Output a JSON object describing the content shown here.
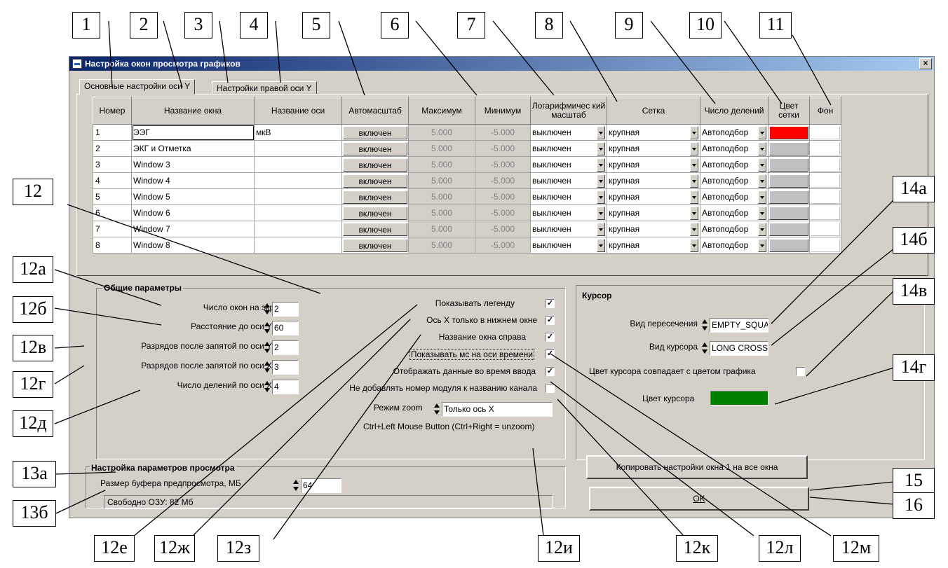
{
  "window": {
    "title": "Настройка окон просмотра графиков",
    "close_label": "×"
  },
  "tabs": [
    {
      "label": "Основные настройки оси Y"
    },
    {
      "label": "Настройки правой оси Y"
    }
  ],
  "table": {
    "headers": [
      "Номер",
      "Название окна",
      "Название оси",
      "Автомасштаб",
      "Максимум",
      "Минимум",
      "Логарифмичес кий масштаб",
      "Сетка",
      "Число делений",
      "Цвет сетки",
      "Фон"
    ],
    "rows": [
      {
        "num": "1",
        "name": "ЭЭГ",
        "axis": "мкВ",
        "auto": "включен",
        "max": "5.000",
        "min": "-5.000",
        "log": "выключен",
        "grid": "крупная",
        "div": "Автоподбор",
        "grid_color": "#ff0000"
      },
      {
        "num": "2",
        "name": "ЭКГ и Отметка",
        "axis": "",
        "auto": "включен",
        "max": "5.000",
        "min": "-5.000",
        "log": "выключен",
        "grid": "крупная",
        "div": "Автоподбор",
        "grid_color": "#c0c0c0"
      },
      {
        "num": "3",
        "name": "Window 3",
        "axis": "",
        "auto": "включен",
        "max": "5.000",
        "min": "-5.000",
        "log": "выключен",
        "grid": "крупная",
        "div": "Автоподбор",
        "grid_color": "#c0c0c0"
      },
      {
        "num": "4",
        "name": "Window 4",
        "axis": "",
        "auto": "включен",
        "max": "5.000",
        "min": "-5.000",
        "log": "выключен",
        "grid": "крупная",
        "div": "Автоподбор",
        "grid_color": "#c0c0c0"
      },
      {
        "num": "5",
        "name": "Window 5",
        "axis": "",
        "auto": "включен",
        "max": "5.000",
        "min": "-5.000",
        "log": "выключен",
        "grid": "крупная",
        "div": "Автоподбор",
        "grid_color": "#c0c0c0"
      },
      {
        "num": "6",
        "name": "Window 6",
        "axis": "",
        "auto": "включен",
        "max": "5.000",
        "min": "-5.000",
        "log": "выключен",
        "grid": "крупная",
        "div": "Автоподбор",
        "grid_color": "#c0c0c0"
      },
      {
        "num": "7",
        "name": "Window 7",
        "axis": "",
        "auto": "включен",
        "max": "5.000",
        "min": "-5.000",
        "log": "выключен",
        "grid": "крупная",
        "div": "Автоподбор",
        "grid_color": "#c0c0c0"
      },
      {
        "num": "8",
        "name": "Window 8",
        "axis": "",
        "auto": "включен",
        "max": "5.000",
        "min": "-5.000",
        "log": "выключен",
        "grid": "крупная",
        "div": "Автоподбор",
        "grid_color": "#c0c0c0"
      }
    ]
  },
  "general": {
    "title": "Общие параметры",
    "windows_on_screen_label": "Число окон на экране",
    "windows_on_screen": "2",
    "distance_label": "Расстояние до оси Y",
    "distance": "60",
    "digits_y_label": "Разрядов после запятой по оси Y",
    "digits_y": "2",
    "digits_x_label": "Разрядов после запятой по оси X",
    "digits_x": "3",
    "divisions_x_label": "Число делений по оси X",
    "divisions_x": "4",
    "show_legend_label": "Показывать легенду",
    "show_legend": "✓",
    "x_axis_bottom_label": "Ось X только в нижнем окне",
    "x_axis_bottom": "✓",
    "name_right_label": "Название окна справа",
    "name_right": "✓",
    "show_ms_label": "Показывать мс на оси времени",
    "show_ms": "✓",
    "show_data_label": "Отображать данные во время ввода",
    "show_data": "✓",
    "no_module_label": "Не добавлять номер модуля к названию канала",
    "no_module": "",
    "zoom_label": "Режим zoom",
    "zoom_value": "Только ось X",
    "zoom_hint": "Ctrl+Left Mouse Button (Ctrl+Right = unzoom)"
  },
  "cursor": {
    "title": "Курсор",
    "intersection_label": "Вид пересечения",
    "intersection": "EMPTY_SQUAF",
    "cursor_type_label": "Вид курсора",
    "cursor_type": "LONG CROSS",
    "match_color_label": "Цвет курсора совпадает с цветом графика",
    "match_color": "",
    "color_label": "Цвет курсора",
    "color": "#008000"
  },
  "view": {
    "title": "Настройка параметров просмотра",
    "buffer_label": "Размер буфера предпросмотра, МБ",
    "buffer": "64",
    "free_ram": "Свободно ОЗУ: 82 Мб"
  },
  "buttons": {
    "copy": "Копировать настройки окна 1 на все окна",
    "ok": "OK"
  },
  "callouts": [
    "1",
    "2",
    "3",
    "4",
    "5",
    "6",
    "7",
    "8",
    "9",
    "10",
    "11",
    "12",
    "12а",
    "12б",
    "12в",
    "12г",
    "12д",
    "13а",
    "13б",
    "12е",
    "12ж",
    "12з",
    "12и",
    "12к",
    "12л",
    "12м",
    "14а",
    "14б",
    "14в",
    "14г",
    "15",
    "16"
  ]
}
